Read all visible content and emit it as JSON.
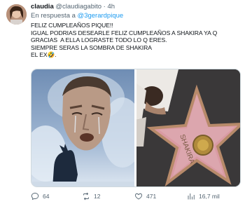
{
  "tweet": {
    "display_name": "claudia",
    "handle": "@claudiagabito",
    "separator": "·",
    "time": "4h",
    "reply_prefix": "En respuesta a",
    "reply_to": "@3gerardpique",
    "text_lines": [
      "FELIZ CUMPLEAÑOS PIQUE!!",
      "IGUAL PODRIAS DESEARLE FELIZ CUMPLEAÑOS A SHAKIRA YA Q",
      "GRACIAS  A ELLA LOGRASTE TODO LO Q ERES.",
      "SIEMPRE SERAS LA SOMBRA DE SHAKIRA",
      "EL EX🤣."
    ],
    "media": {
      "left_description_icon": "crying-man-wolf-image",
      "right_description_icon": "walk-of-fame-star-image",
      "star_text": "SHAKIRA"
    },
    "actions": {
      "replies": "64",
      "retweets": "12",
      "likes": "471",
      "views": "16,7 mil"
    }
  },
  "colors": {
    "link": "#1d9bf0",
    "secondary": "#536471",
    "primary_text": "#0f1419"
  }
}
